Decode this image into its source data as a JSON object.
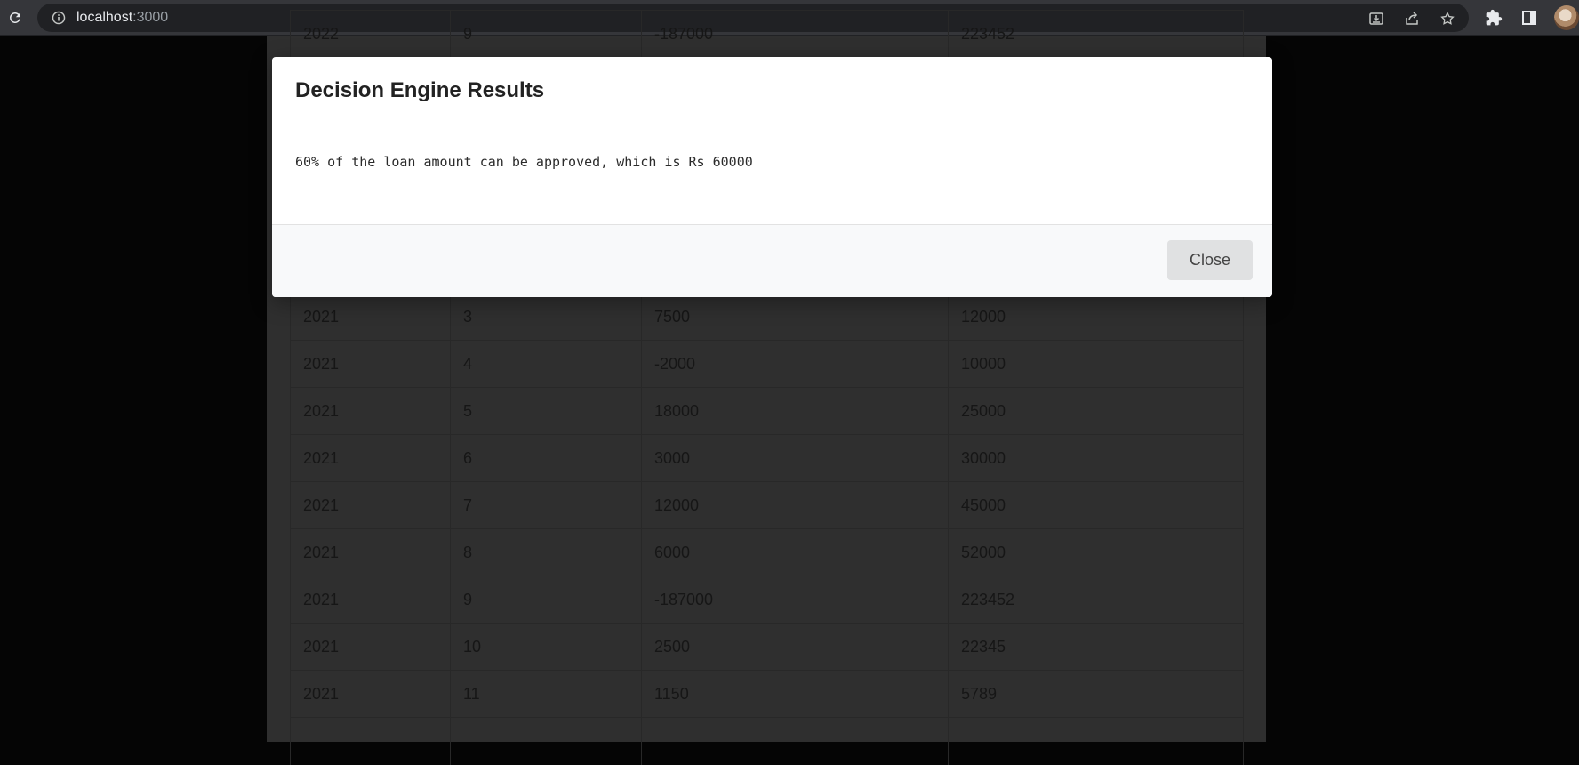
{
  "browser": {
    "url_host": "localhost",
    "url_port": ":3000",
    "icons": [
      "reload-icon",
      "info-icon",
      "install-icon",
      "share-icon",
      "star-icon",
      "extensions-icon",
      "side-panel-icon",
      "avatar"
    ]
  },
  "table": {
    "rows": [
      [
        "2022",
        "9",
        "-187000",
        "223452"
      ],
      [
        "",
        "",
        "",
        ""
      ],
      [
        "",
        "",
        "",
        ""
      ],
      [
        "",
        "",
        "",
        ""
      ],
      [
        "",
        "",
        "",
        ""
      ],
      [
        "",
        "",
        "",
        ""
      ],
      [
        "2021",
        "3",
        "7500",
        "12000"
      ],
      [
        "2021",
        "4",
        "-2000",
        "10000"
      ],
      [
        "2021",
        "5",
        "18000",
        "25000"
      ],
      [
        "2021",
        "6",
        "3000",
        "30000"
      ],
      [
        "2021",
        "7",
        "12000",
        "45000"
      ],
      [
        "2021",
        "8",
        "6000",
        "52000"
      ],
      [
        "2021",
        "9",
        "-187000",
        "223452"
      ],
      [
        "2021",
        "10",
        "2500",
        "22345"
      ],
      [
        "2021",
        "11",
        "1150",
        "5789"
      ],
      [
        "",
        "",
        "",
        ""
      ]
    ]
  },
  "modal": {
    "title": "Decision Engine Results",
    "message": "60% of the loan amount can be approved, which is Rs 60000",
    "close_label": "Close"
  }
}
